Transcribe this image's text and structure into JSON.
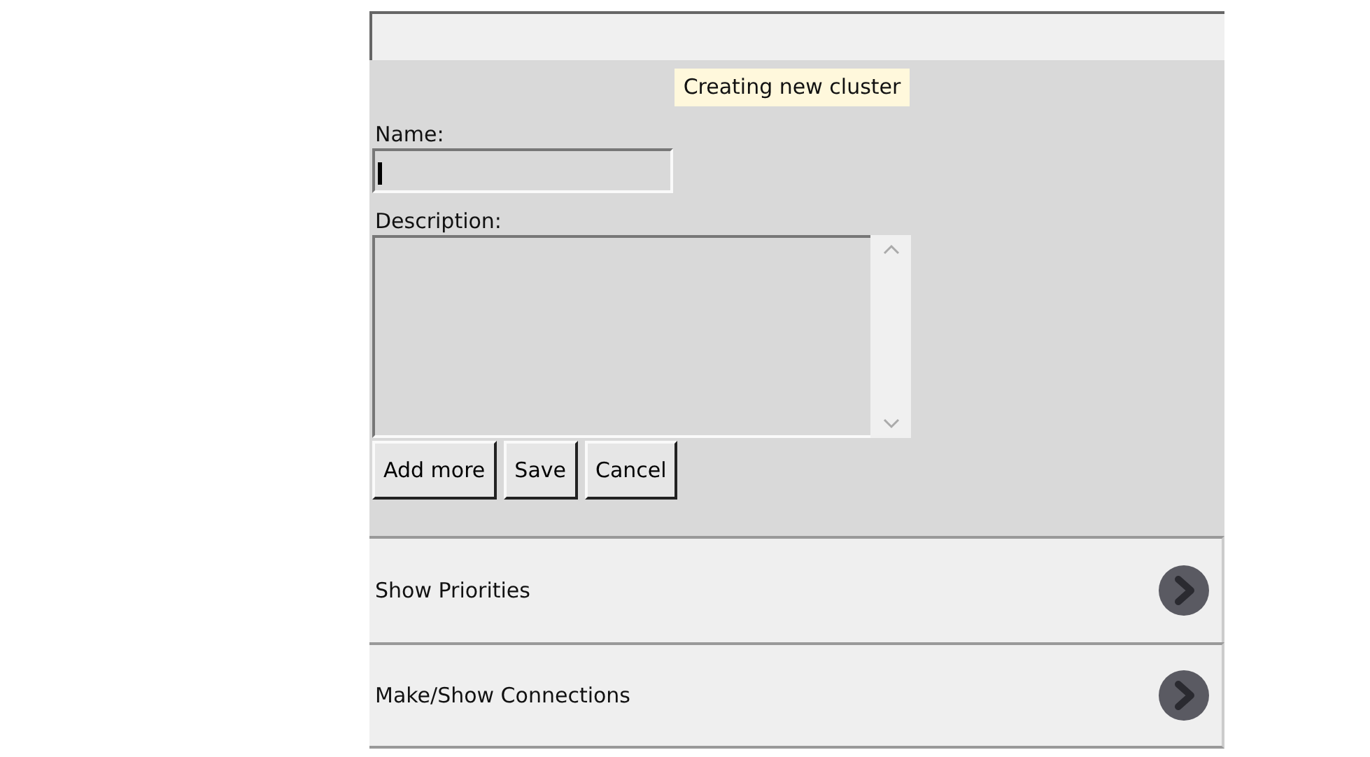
{
  "tooltip": {
    "text": "Creating new cluster"
  },
  "form": {
    "fields": [
      {
        "kind": "line",
        "label": "Name:",
        "focused": true
      },
      {
        "kind": "multiline",
        "label": "Description:",
        "focused": false
      }
    ],
    "buttons": [
      "Add more",
      "Save",
      "Cancel"
    ]
  },
  "sections": [
    {
      "label": "Show Priorities"
    },
    {
      "label": "Make/Show Connections"
    }
  ]
}
